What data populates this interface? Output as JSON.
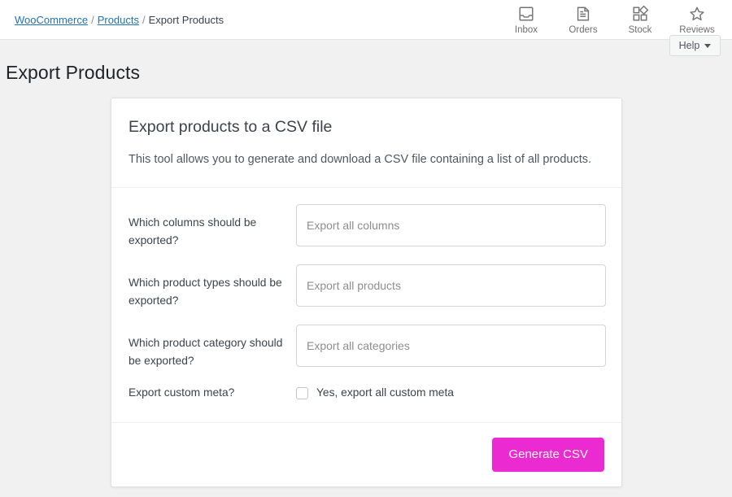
{
  "topbar": {
    "breadcrumb": {
      "items": [
        {
          "label": "WooCommerce",
          "link": true
        },
        {
          "label": "Products",
          "link": true
        },
        {
          "label": "Export Products",
          "link": false
        }
      ],
      "separator": "/"
    },
    "nav_icons": [
      {
        "icon": "inbox-icon",
        "label": "Inbox"
      },
      {
        "icon": "orders-document-icon",
        "label": "Orders"
      },
      {
        "icon": "stock-grid-icon",
        "label": "Stock"
      },
      {
        "icon": "reviews-star-icon",
        "label": "Reviews"
      }
    ],
    "help": {
      "label": "Help",
      "caret_icon": "chevron-down-icon"
    }
  },
  "page": {
    "title": "Export Products"
  },
  "card": {
    "title": "Export products to a CSV file",
    "description": "This tool allows you to generate and download a CSV file containing a list of all products.",
    "rows": [
      {
        "label": "Which columns should be exported?",
        "placeholder": "Export all columns",
        "value": ""
      },
      {
        "label": "Which product types should be exported?",
        "placeholder": "Export all products",
        "value": ""
      },
      {
        "label": "Which product category should be exported?",
        "placeholder": "Export all categories",
        "value": ""
      }
    ],
    "custom_meta": {
      "label": "Export custom meta?",
      "checkbox_label": "Yes, export all custom meta",
      "checked": false
    },
    "footer": {
      "generate_label": "Generate CSV"
    }
  },
  "colors": {
    "accent_button": "#ec2ad2",
    "link": "#2271b1",
    "page_background": "#f1f1f1",
    "card_background": "#ffffff",
    "title_text": "#1d2327"
  }
}
